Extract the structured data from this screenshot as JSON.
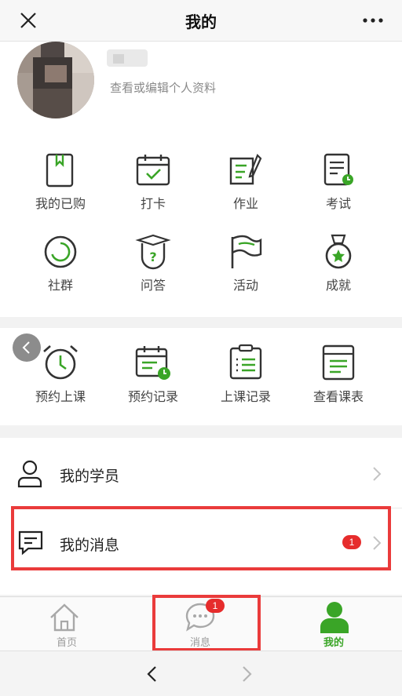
{
  "header": {
    "title": "我的"
  },
  "profile": {
    "edit_label": "查看或编辑个人资料"
  },
  "grid_top": [
    {
      "label": "我的已购",
      "icon": "book-icon"
    },
    {
      "label": "打卡",
      "icon": "calendar-check-icon"
    },
    {
      "label": "作业",
      "icon": "homework-icon"
    },
    {
      "label": "考试",
      "icon": "exam-icon"
    },
    {
      "label": "社群",
      "icon": "community-icon"
    },
    {
      "label": "问答",
      "icon": "qa-icon"
    },
    {
      "label": "活动",
      "icon": "flag-icon"
    },
    {
      "label": "成就",
      "icon": "medal-icon"
    }
  ],
  "grid_bottom": [
    {
      "label": "预约上课",
      "icon": "alarm-clock-icon"
    },
    {
      "label": "预约记录",
      "icon": "calendar-clock-icon"
    },
    {
      "label": "上课记录",
      "icon": "clipboard-list-icon"
    },
    {
      "label": "查看课表",
      "icon": "schedule-icon"
    }
  ],
  "list": {
    "students_label": "我的学员",
    "messages_label": "我的消息",
    "messages_badge": "1"
  },
  "tabs": {
    "home_label": "首页",
    "messages_label": "消息",
    "messages_badge": "1",
    "mine_label": "我的"
  },
  "colors": {
    "accent": "#3aa527",
    "badge": "#e62c2c",
    "highlight": "#ea3b3b"
  }
}
